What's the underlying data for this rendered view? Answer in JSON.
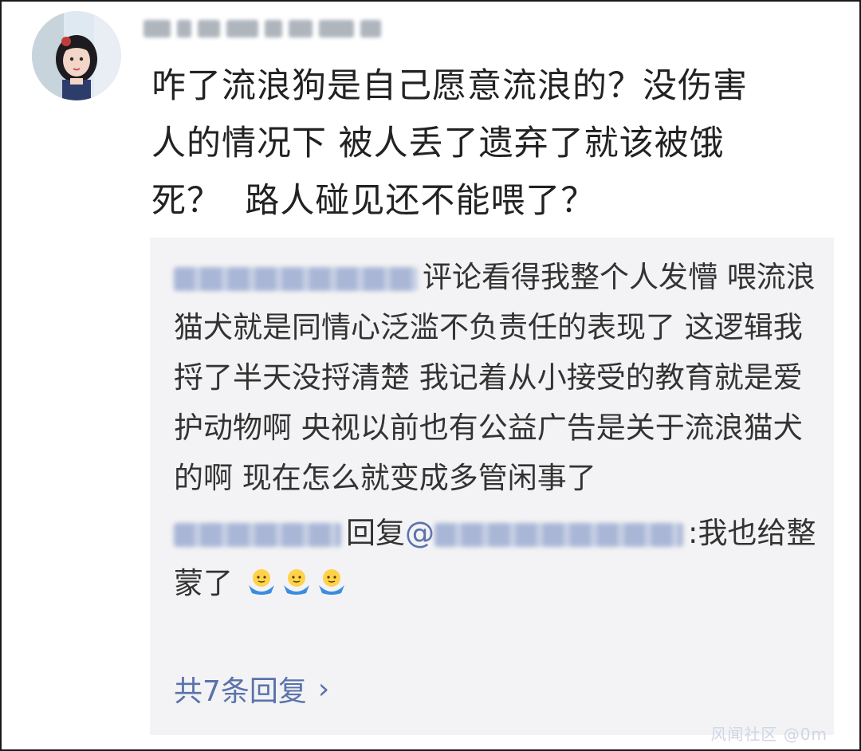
{
  "comment": {
    "text_lines": [
      "咋了流浪狗是自己愿意流浪的？没伤害",
      "人的情况下 被人丢了遗弃了就该被饿",
      "死？  路人碰见还不能喂了？"
    ]
  },
  "reply": {
    "text": "评论看得我整个人发懵 喂流浪猫犬就是同情心泛滥不负责任的表现了 这逻辑我捋了半天没捋清楚 我记着从小接受的教育就是爱护动物啊 央视以前也有公益广告是关于流浪猫犬的啊 现在怎么就变成多管闲事了",
    "sub_reply_word": "回复",
    "at_symbol": "@",
    "sub_reply_text": ":我也给整蒙了"
  },
  "more_replies": {
    "label": "共7条回复",
    "chevron": "›"
  },
  "watermark": "风闻社区 @0m",
  "icons": {
    "avatar": "avatar-image",
    "emoji": "shrug-emoji",
    "chevron": "chevron-right-icon"
  },
  "colors": {
    "link": "#5b72ab",
    "reply_bg": "#f3f3f5"
  }
}
